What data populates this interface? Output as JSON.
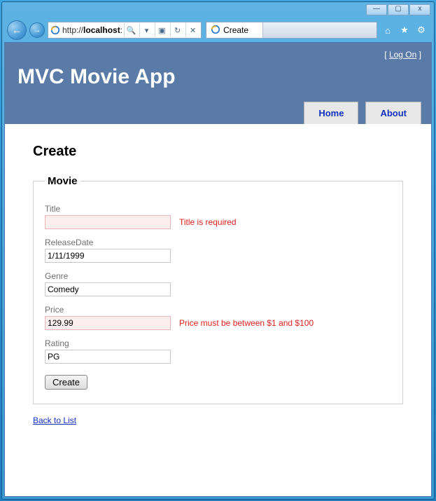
{
  "window": {
    "min_label": "—",
    "max_label": "▢",
    "close_label": "x"
  },
  "browser": {
    "url_prefix": "http://",
    "url_host": "localhost",
    "url_suffix": ":",
    "tab_title": "Create",
    "back_glyph": "←",
    "fwd_glyph": "→",
    "search_glyph": "🔍",
    "dropdown_glyph": "▾",
    "combine_glyph": "▣",
    "refresh_glyph": "↻",
    "stop_glyph": "✕",
    "home_glyph": "⌂",
    "star_glyph": "★",
    "gear_glyph": "⚙"
  },
  "page": {
    "logon_text": "Log On",
    "app_title": "MVC Movie App",
    "nav_home": "Home",
    "nav_about": "About",
    "heading": "Create",
    "legend": "Movie",
    "fields": {
      "title": {
        "label": "Title",
        "value": "",
        "error": "Title is required"
      },
      "releasedate": {
        "label": "ReleaseDate",
        "value": "1/11/1999",
        "error": ""
      },
      "genre": {
        "label": "Genre",
        "value": "Comedy",
        "error": ""
      },
      "price": {
        "label": "Price",
        "value": "129.99",
        "error": "Price must be between $1 and $100"
      },
      "rating": {
        "label": "Rating",
        "value": "PG",
        "error": ""
      }
    },
    "submit_label": "Create",
    "back_link": "Back to List"
  }
}
